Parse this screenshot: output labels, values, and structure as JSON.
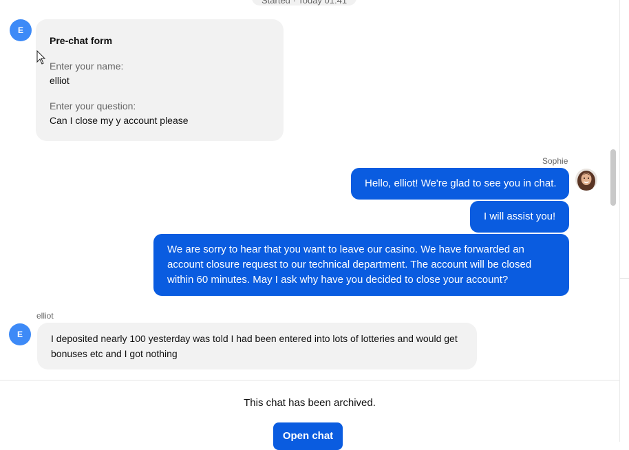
{
  "header": {
    "started_label": "Started · Today 01:41"
  },
  "prechat": {
    "avatar_initial": "E",
    "title": "Pre-chat form",
    "name_label": "Enter your name:",
    "name_value": "elliot",
    "question_label": "Enter your question:",
    "question_value": "Can I close my y account please"
  },
  "agent": {
    "name": "Sophie",
    "messages": [
      "Hello, elliot! We're glad to see you in chat.",
      "I will assist you!",
      "We are sorry to hear that you want to leave our casino. We have forwarded an account closure request to our technical department. The account will be closed within 60 minutes. May I ask why have you decided to close your account?"
    ]
  },
  "customer": {
    "name": "elliot",
    "avatar_initial": "E",
    "message": "I deposited nearly 100 yesterday was told I had been entered into lots of lotteries and would get bonuses etc and I got nothing"
  },
  "footer": {
    "archived_text": "This chat has been archived.",
    "open_chat_label": "Open chat"
  },
  "colors": {
    "accent": "#0a5ce0",
    "avatar": "#3d8af7",
    "bubble_grey": "#f2f2f2"
  }
}
